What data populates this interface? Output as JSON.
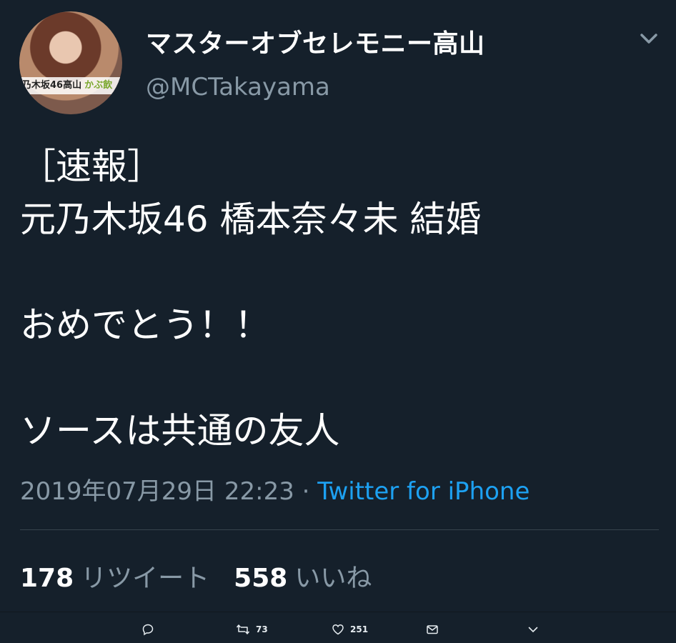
{
  "profile": {
    "display_name": "マスターオブセレモニー高山",
    "handle": "@MCTakayama",
    "avatar_caption": "乃木坂46高山",
    "avatar_caption_tail": "かぶ飲"
  },
  "tweet": {
    "text": " ［速報］\n元乃木坂46 橋本奈々未 結婚\n\nおめでとう！！\n\nソースは共通の友人",
    "timestamp": "2019年07月29日 22:23",
    "separator": "·",
    "source": "Twitter for iPhone"
  },
  "stats": {
    "retweets": "178",
    "retweets_label": "リツイート",
    "likes": "558",
    "likes_label": "いいね"
  },
  "actions": {
    "reply_icon": "reply-icon",
    "retweet_icon": "retweet-icon",
    "retweet_count": "73",
    "like_icon": "heart-icon",
    "like_count": "251",
    "dm_icon": "mail-icon",
    "more_icon": "chevron-down-icon"
  },
  "colors": {
    "background": "#15202b",
    "secondary_text": "#8899a6",
    "link": "#1da1f2"
  }
}
